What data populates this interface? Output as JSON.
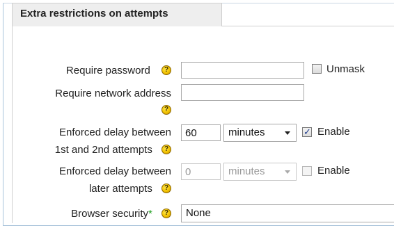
{
  "section": {
    "legend": "Extra restrictions on attempts"
  },
  "require_password": {
    "label": "Require password",
    "value": "",
    "unmask_label": "Unmask",
    "unmask_checked": false
  },
  "require_network": {
    "label": "Require network address",
    "value": ""
  },
  "delay_first": {
    "label_line1": "Enforced delay between",
    "label_line2": "1st and 2nd attempts",
    "value": "60",
    "unit": "minutes",
    "enable_label": "Enable",
    "enabled": true
  },
  "delay_later": {
    "label_line1": "Enforced delay between",
    "label_line2": "later attempts",
    "value": "0",
    "unit": "minutes",
    "enable_label": "Enable",
    "enabled": false
  },
  "browser_security": {
    "label": "Browser security",
    "required_mark": "*",
    "value": "None"
  },
  "help_glyph": "?",
  "colors": {
    "required": "#22a022",
    "help_icon": "#f2c200",
    "legend_bg": "#eeeeee"
  }
}
